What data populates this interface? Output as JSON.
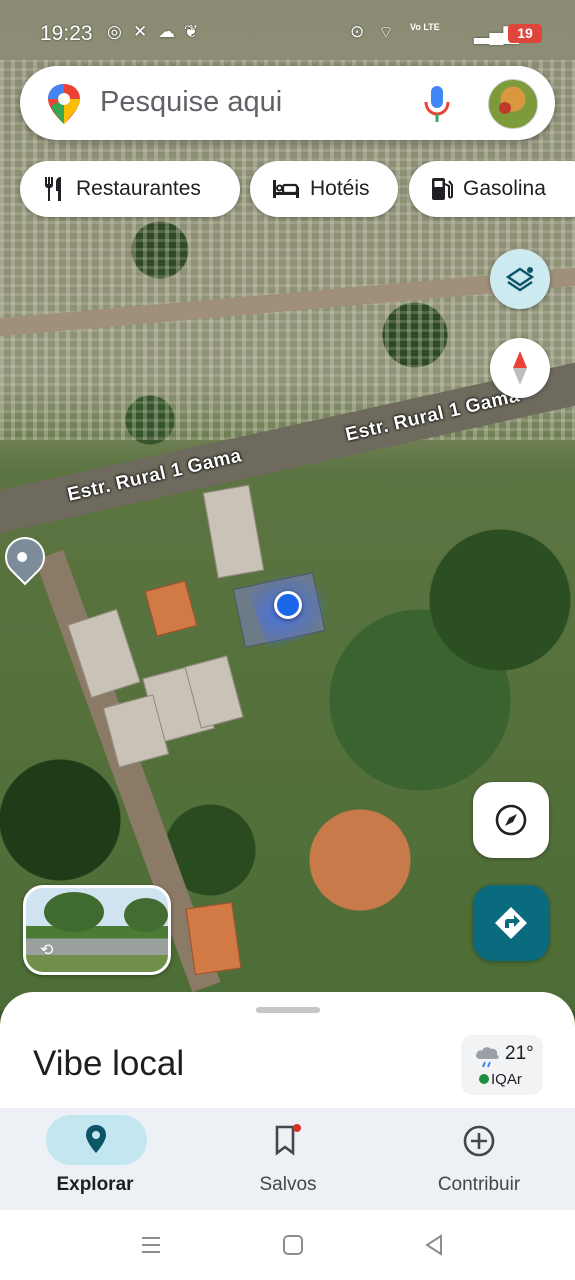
{
  "status_bar": {
    "time": "19:23",
    "volte": "Vo LTE",
    "battery": "19",
    "icons": [
      "whatsapp-icon",
      "network-icon",
      "leaf-icon",
      "location-icon",
      "wifi-icon",
      "signal-icon"
    ]
  },
  "search": {
    "placeholder": "Pesquise aqui",
    "icons": [
      "maps-pin-icon",
      "mic-icon",
      "avatar"
    ]
  },
  "chips": [
    {
      "label": "Restaurantes",
      "icon": "restaurant-icon"
    },
    {
      "label": "Hotéis",
      "icon": "hotel-icon"
    },
    {
      "label": "Gasolina",
      "icon": "gas-station-icon"
    }
  ],
  "map": {
    "road_label_1": "Estr. Rural 1 Gama",
    "road_label_2": "Estr. Rural 1 Gama",
    "view": "satellite"
  },
  "sheet": {
    "title": "Vibe local",
    "weather": {
      "temp": "21°",
      "aqi_label": "IQAr",
      "icon": "cloud-rain-icon",
      "aqi_color": "#1e8e3e"
    }
  },
  "nav": {
    "items": [
      {
        "label": "Explorar",
        "icon": "pin-icon",
        "active": true
      },
      {
        "label": "Salvos",
        "icon": "bookmark-icon",
        "active": false
      },
      {
        "label": "Contribuir",
        "icon": "add-circle-icon",
        "active": false
      }
    ]
  },
  "colors": {
    "accent": "#0b6b7e",
    "active_pill": "#c2e7f0",
    "location_dot": "#1a66e8"
  }
}
